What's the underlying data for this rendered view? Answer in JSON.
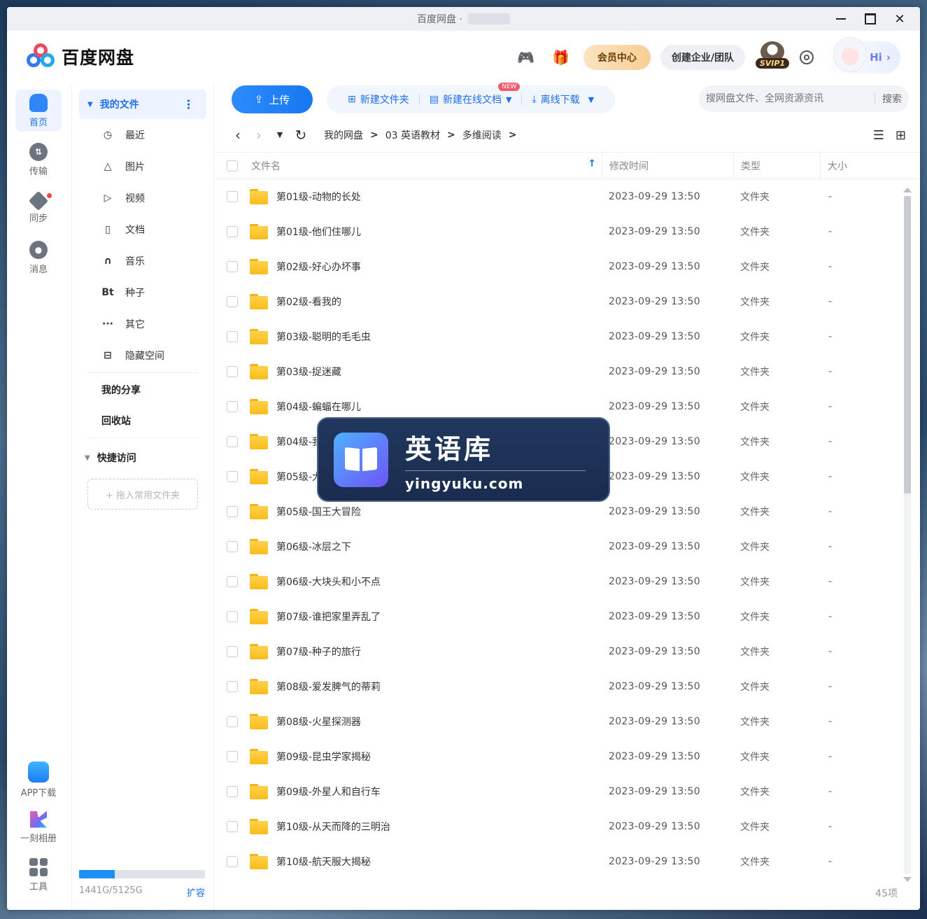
{
  "window": {
    "title": "百度网盘 ·"
  },
  "header": {
    "logo_text": "百度网盘",
    "vip_label": "会员中心",
    "team_label": "创建企业/团队",
    "svip_tag": "SVIP1",
    "hi_label": "Hi",
    "hi_chevron": "›"
  },
  "rail": {
    "items": [
      {
        "label": "首页",
        "icon": "home-icon",
        "active": true
      },
      {
        "label": "传输",
        "icon": "transfer-icon"
      },
      {
        "label": "同步",
        "icon": "sync-icon"
      },
      {
        "label": "消息",
        "icon": "message-icon"
      }
    ],
    "bottom": [
      {
        "label": "APP下载",
        "icon": "app-download-icon"
      },
      {
        "label": "一刻相册",
        "icon": "album-icon"
      },
      {
        "label": "工具",
        "icon": "tools-icon"
      }
    ]
  },
  "sidebar": {
    "my_files": "我的文件",
    "items": [
      {
        "label": "最近",
        "icon": "clock-icon",
        "glyph": "◷"
      },
      {
        "label": "图片",
        "icon": "image-icon",
        "glyph": "△"
      },
      {
        "label": "视频",
        "icon": "video-icon",
        "glyph": "▷"
      },
      {
        "label": "文档",
        "icon": "document-icon",
        "glyph": "▯"
      },
      {
        "label": "音乐",
        "icon": "headphones-icon",
        "glyph": "∩"
      },
      {
        "label": "种子",
        "icon": "bt-icon",
        "glyph": "Bt"
      },
      {
        "label": "其它",
        "icon": "more-icon",
        "glyph": "···"
      },
      {
        "label": "隐藏空间",
        "icon": "lock-icon",
        "glyph": "⊟"
      }
    ],
    "my_share": "我的分享",
    "recycle": "回收站",
    "quick_access": "快捷访问",
    "drop_hint": "+ 拖入常用文件夹",
    "storage": {
      "text": "1441G/5125G",
      "used_fraction": 0.281,
      "expand": "扩容"
    }
  },
  "toolbar": {
    "upload": "上传",
    "new_folder": "新建文件夹",
    "new_online_doc": "新建在线文档",
    "new_badge": "NEW",
    "offline_download": "离线下载",
    "search_placeholder": "搜网盘文件、全网资源资讯",
    "search_button": "搜索"
  },
  "path": {
    "crumbs": [
      "我的网盘",
      "03 英语教材",
      "多维阅读"
    ]
  },
  "table": {
    "headers": {
      "name": "文件名",
      "time": "修改时间",
      "type": "类型",
      "size": "大小"
    },
    "rows": [
      {
        "name": "第01级-动物的长处",
        "time": "2023-09-29 13:50",
        "type": "文件夹",
        "size": "-"
      },
      {
        "name": "第01级-他们住哪儿",
        "time": "2023-09-29 13:50",
        "type": "文件夹",
        "size": "-"
      },
      {
        "name": "第02级-好心办坏事",
        "time": "2023-09-29 13:50",
        "type": "文件夹",
        "size": "-"
      },
      {
        "name": "第02级-看我的",
        "time": "2023-09-29 13:50",
        "type": "文件夹",
        "size": "-"
      },
      {
        "name": "第03级-聪明的毛毛虫",
        "time": "2023-09-29 13:50",
        "type": "文件夹",
        "size": "-"
      },
      {
        "name": "第03级-捉迷藏",
        "time": "2023-09-29 13:50",
        "type": "文件夹",
        "size": "-"
      },
      {
        "name": "第04级-蝙蝠在哪儿",
        "time": "2023-09-29 13:50",
        "type": "文件夹",
        "size": "-"
      },
      {
        "name": "第04级-我",
        "time": "2023-09-29 13:50",
        "type": "文件夹",
        "size": "-"
      },
      {
        "name": "第05级-大",
        "time": "2023-09-29 13:50",
        "type": "文件夹",
        "size": "-"
      },
      {
        "name": "第05级-国王大冒险",
        "time": "2023-09-29 13:50",
        "type": "文件夹",
        "size": "-"
      },
      {
        "name": "第06级-冰层之下",
        "time": "2023-09-29 13:50",
        "type": "文件夹",
        "size": "-"
      },
      {
        "name": "第06级-大块头和小不点",
        "time": "2023-09-29 13:50",
        "type": "文件夹",
        "size": "-"
      },
      {
        "name": "第07级-谁把家里弄乱了",
        "time": "2023-09-29 13:50",
        "type": "文件夹",
        "size": "-"
      },
      {
        "name": "第07级-种子的旅行",
        "time": "2023-09-29 13:50",
        "type": "文件夹",
        "size": "-"
      },
      {
        "name": "第08级-爱发脾气的蒂莉",
        "time": "2023-09-29 13:50",
        "type": "文件夹",
        "size": "-"
      },
      {
        "name": "第08级-火星探测器",
        "time": "2023-09-29 13:50",
        "type": "文件夹",
        "size": "-"
      },
      {
        "name": "第09级-昆虫学家揭秘",
        "time": "2023-09-29 13:50",
        "type": "文件夹",
        "size": "-"
      },
      {
        "name": "第09级-外星人和自行车",
        "time": "2023-09-29 13:50",
        "type": "文件夹",
        "size": "-"
      },
      {
        "name": "第10级-从天而降的三明治",
        "time": "2023-09-29 13:50",
        "type": "文件夹",
        "size": "-"
      },
      {
        "name": "第10级-航天服大揭秘",
        "time": "2023-09-29 13:50",
        "type": "文件夹",
        "size": "-"
      }
    ],
    "count": "45项",
    "scroll_fraction": 0.44
  },
  "watermark": {
    "title": "英语库",
    "url": "yingyuku.com"
  },
  "colors": {
    "accent": "#1e6ff0",
    "folder": "#ffd14a",
    "vip_gold": "#f7cf94"
  }
}
